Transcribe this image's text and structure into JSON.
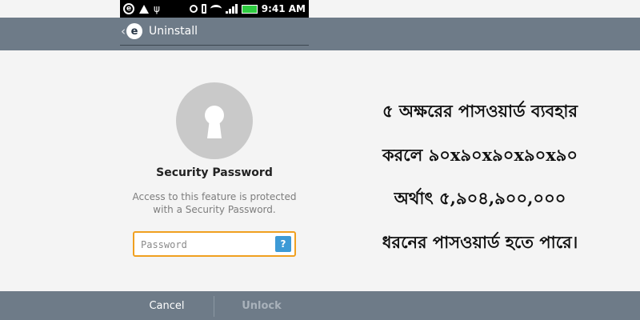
{
  "status_bar": {
    "icons": [
      "eset-notification-icon",
      "warning-icon",
      "usb-icon",
      "gps-icon",
      "vibrate-icon",
      "wifi-icon",
      "signal-icon",
      "battery-icon"
    ],
    "time": "9:41 AM"
  },
  "header": {
    "back_glyph": "‹",
    "logo_letter": "e",
    "title": "Uninstall"
  },
  "security": {
    "title": "Security Password",
    "description_line1": "Access to this feature is protected",
    "description_line2": "with a Security Password.",
    "password_placeholder": "Password",
    "password_value": "",
    "help_label": "?"
  },
  "buttons": {
    "cancel": "Cancel",
    "unlock": "Unlock"
  },
  "bengali_text": [
    "৫ অক্ষরের পাসওয়ার্ড ব্যবহার",
    "করলে ৯০x৯০x৯০x৯০x৯০",
    "অর্থাৎ ৫,৯০৪,৯০০,০০০",
    "ধরনের পাসওয়ার্ড হতে পারে।"
  ],
  "colors": {
    "bar": "#6e7b88",
    "field_border": "#f0a020",
    "help_button": "#3d9ad6",
    "lock_circle": "#c9c9c9"
  }
}
